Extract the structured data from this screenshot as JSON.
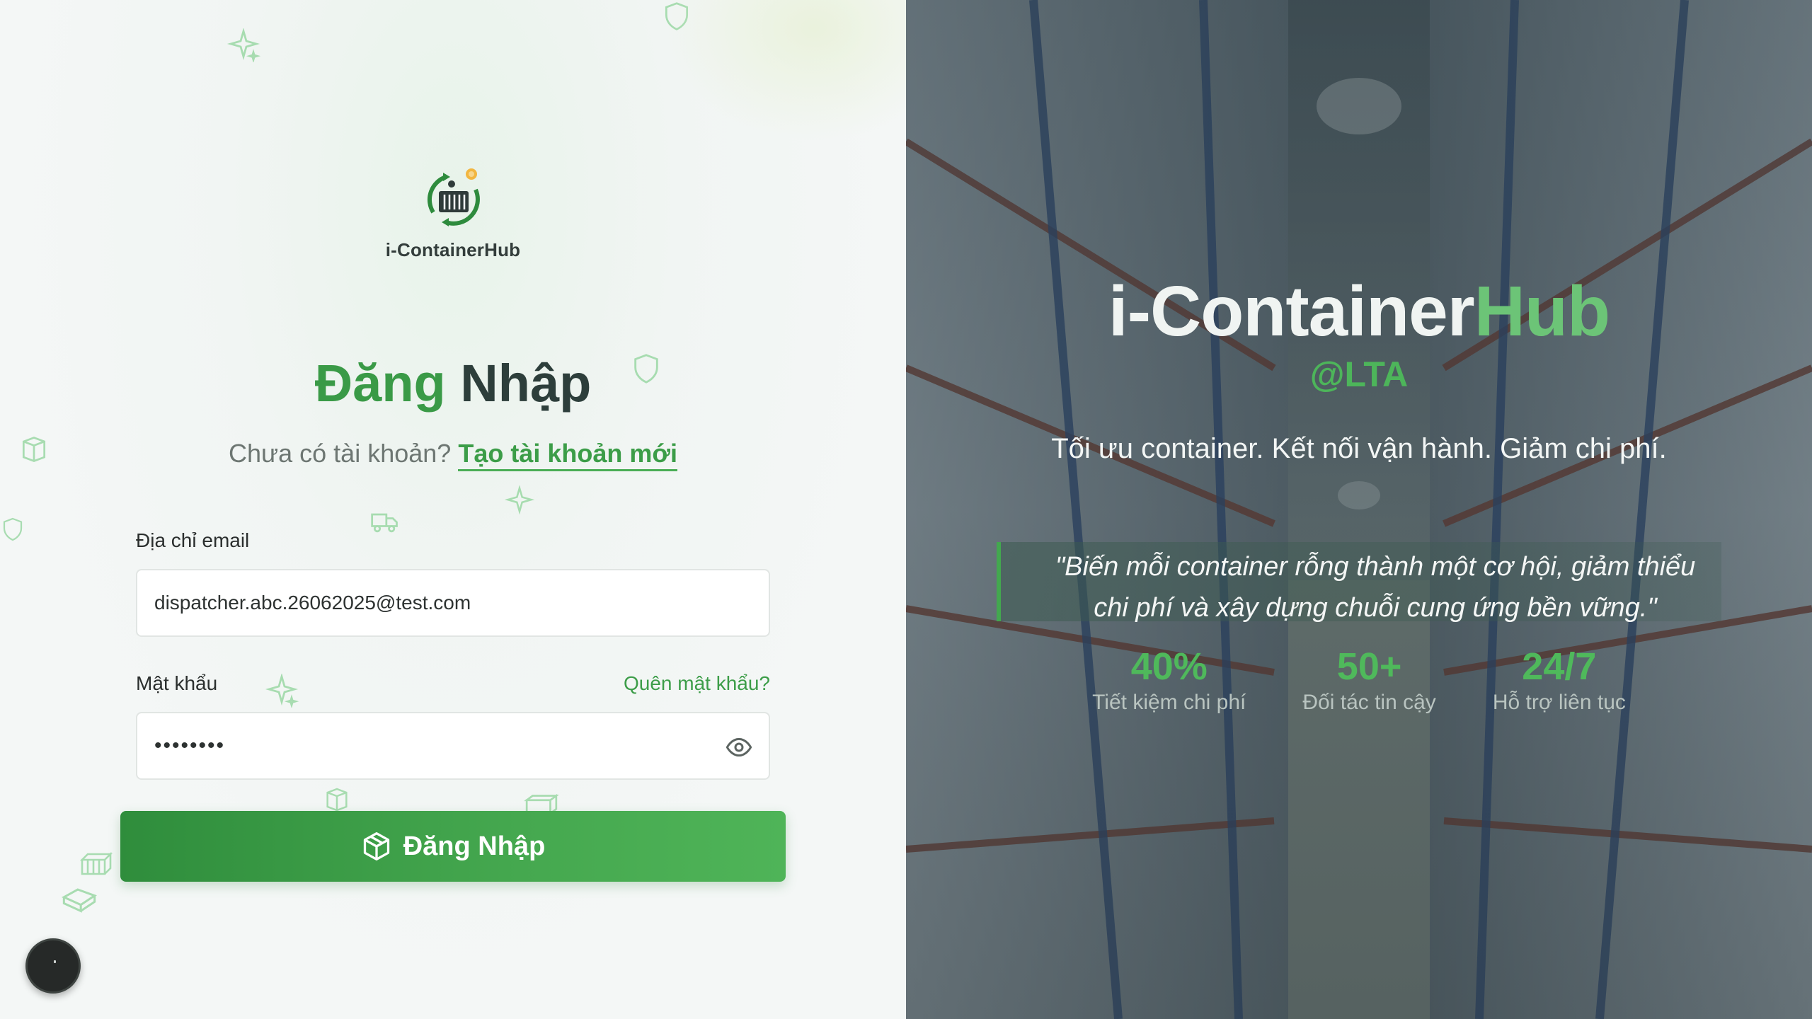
{
  "brand": {
    "logo_text": "i-ContainerHub",
    "accent": "#3a9a47"
  },
  "login": {
    "title_part1": "Đăng",
    "title_part2": "Nhập",
    "signup_prompt": "Chưa có tài khoản?",
    "signup_link": "Tạo tài khoản mới",
    "email_label": "Địa chỉ email",
    "email_value": "dispatcher.abc.26062025@test.com",
    "password_label": "Mật khẩu",
    "forgot_link": "Quên mật khẩu?",
    "password_mask": "••••••••",
    "submit_label": "Đăng Nhập"
  },
  "hero": {
    "title_part1": "i-Container",
    "title_part2": "Hub",
    "handle": "@LTA",
    "tagline": "Tối ưu container. Kết nối vận hành. Giảm chi phí.",
    "quote": "\"Biến mỗi container rỗng thành một cơ hội, giảm thiểu chi phí và xây dựng chuỗi cung ứng bền vững.\"",
    "stats": [
      {
        "value": "40%",
        "label": "Tiết kiệm chi phí"
      },
      {
        "value": "50+",
        "label": "Đối tác tin cậy"
      },
      {
        "value": "24/7",
        "label": "Hỗ trợ liên tục"
      }
    ]
  }
}
